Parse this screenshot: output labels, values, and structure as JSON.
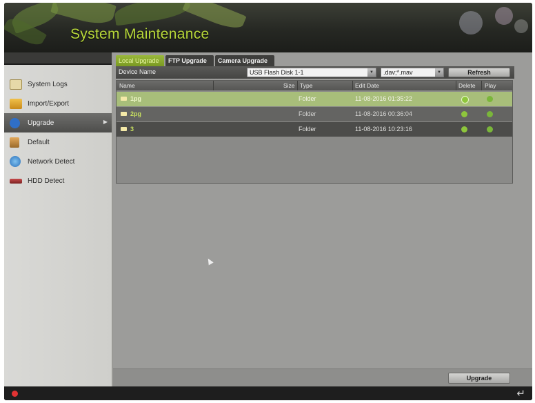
{
  "header": {
    "title": "System Maintenance"
  },
  "sidebar": {
    "items": [
      {
        "label": "System Logs",
        "icon": "log-icon",
        "color": "#d8c07a"
      },
      {
        "label": "Import/Export",
        "icon": "folder-icon",
        "color": "#e0a32a"
      },
      {
        "label": "Upgrade",
        "icon": "upgrade-icon",
        "color": "#2f6fc7",
        "active": true
      },
      {
        "label": "Default",
        "icon": "default-icon",
        "color": "#c98c3a"
      },
      {
        "label": "Network Detect",
        "icon": "network-icon",
        "color": "#3f8fd6"
      },
      {
        "label": "HDD Detect",
        "icon": "hdd-icon",
        "color": "#b53a3a"
      }
    ]
  },
  "tabs": [
    {
      "label": "Local Upgrade",
      "active": true
    },
    {
      "label": "FTP Upgrade"
    },
    {
      "label": "Camera Upgrade"
    }
  ],
  "device": {
    "label": "Device Name",
    "selected": "USB Flash Disk 1-1",
    "filter": ".dav;*.mav",
    "refresh_label": "Refresh"
  },
  "table": {
    "headers": {
      "name": "Name",
      "size": "Size",
      "type": "Type",
      "edit_date": "Edit Date",
      "delete": "Delete",
      "play": "Play"
    },
    "rows": [
      {
        "name": "1pg",
        "type": "Folder",
        "edit_date": "11-08-2016 01:35:22",
        "selected": true
      },
      {
        "name": "2pg",
        "type": "Folder",
        "edit_date": "11-08-2016 00:36:04"
      },
      {
        "name": "3",
        "type": "Folder",
        "edit_date": "11-08-2016 10:23:16"
      }
    ]
  },
  "footer": {
    "upgrade_label": "Upgrade"
  },
  "colors": {
    "accent": "#b8d83a",
    "selected_row": "#a8be7a",
    "delete_dot": "#8ec63c",
    "play_dot": "#7ab63a",
    "record": "#e23333"
  }
}
